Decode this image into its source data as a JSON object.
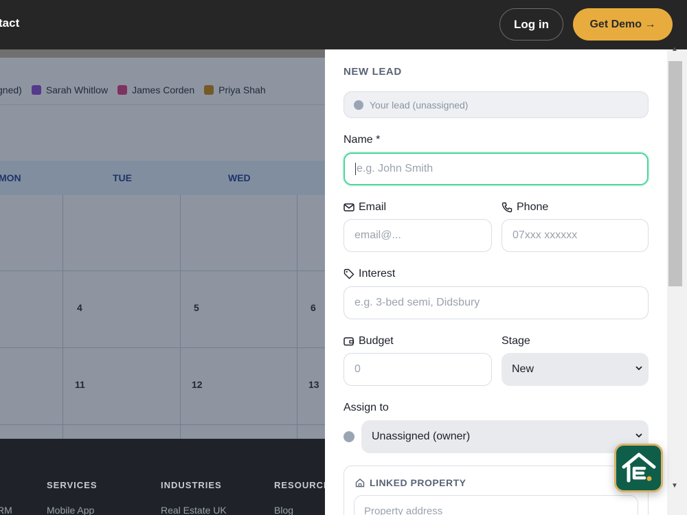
{
  "header": {
    "contact_label": "tact",
    "login_label": "Log in",
    "demo_label": "Get Demo →"
  },
  "calendar": {
    "legend": [
      {
        "label": "gned)",
        "color": ""
      },
      {
        "label": "Sarah Whitlow",
        "color": "#7a46c9"
      },
      {
        "label": "James Corden",
        "color": "#c23a7c"
      },
      {
        "label": "Priya Shah",
        "color": "#b27d1c"
      }
    ],
    "weekdays": [
      "MON",
      "TUE",
      "WED"
    ],
    "days": [
      "4",
      "5",
      "6",
      "11",
      "12",
      "13"
    ]
  },
  "footer": {
    "columns": [
      "SERVICES",
      "INDUSTRIES",
      "RESOURCE"
    ],
    "links": [
      "RM",
      "Mobile App",
      "Real Estate UK",
      "Blog"
    ]
  },
  "form": {
    "title": "NEW LEAD",
    "owner_pill": "Your lead (unassigned)",
    "name_label": "Name *",
    "name_placeholder": "e.g. John Smith",
    "email_label": "Email",
    "email_placeholder": "email@...",
    "phone_label": "Phone",
    "phone_placeholder": "07xxx xxxxxx",
    "interest_label": "Interest",
    "interest_placeholder": "e.g. 3-bed semi, Didsbury",
    "budget_label": "Budget",
    "budget_placeholder": "0",
    "stage_label": "Stage",
    "stage_value": "New",
    "assign_label": "Assign to",
    "assign_value": "Unassigned (owner)",
    "linked_title": "LINKED PROPERTY",
    "linked_placeholder": "Property address"
  },
  "colors": {
    "accent": "#e8ac3e",
    "focus": "#4ad59b",
    "brand": "#0f5e4a"
  }
}
